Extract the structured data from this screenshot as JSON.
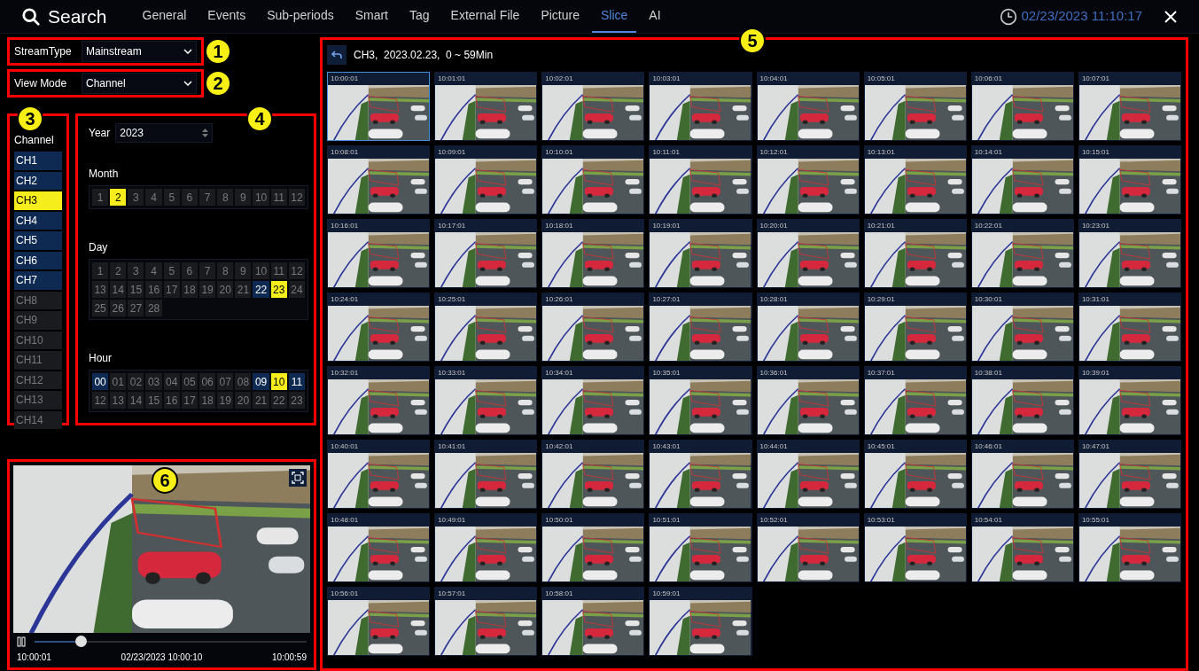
{
  "header": {
    "title": "Search",
    "datetime": "02/23/2023 11:10:17",
    "tabs": [
      {
        "label": "General",
        "selected": false
      },
      {
        "label": "Events",
        "selected": false
      },
      {
        "label": "Sub-periods",
        "selected": false
      },
      {
        "label": "Smart",
        "selected": false
      },
      {
        "label": "Tag",
        "selected": false
      },
      {
        "label": "External File",
        "selected": false
      },
      {
        "label": "Picture",
        "selected": false
      },
      {
        "label": "Slice",
        "selected": true
      },
      {
        "label": "AI",
        "selected": false
      }
    ]
  },
  "filters": [
    {
      "label": "StreamType",
      "value": "Mainstream",
      "callout": "1"
    },
    {
      "label": "View Mode",
      "value": "Channel",
      "callout": "2"
    }
  ],
  "channels": {
    "callout": "3",
    "title": "Channel",
    "items": [
      {
        "label": "CH1",
        "selected": false,
        "recorded": true
      },
      {
        "label": "CH2",
        "selected": false,
        "recorded": true
      },
      {
        "label": "CH3",
        "selected": true,
        "recorded": true
      },
      {
        "label": "CH4",
        "selected": false,
        "recorded": true
      },
      {
        "label": "CH5",
        "selected": false,
        "recorded": true
      },
      {
        "label": "CH6",
        "selected": false,
        "recorded": true
      },
      {
        "label": "CH7",
        "selected": false,
        "recorded": true
      },
      {
        "label": "CH8",
        "selected": false,
        "recorded": false
      },
      {
        "label": "CH9",
        "selected": false,
        "recorded": false
      },
      {
        "label": "CH10",
        "selected": false,
        "recorded": false
      },
      {
        "label": "CH11",
        "selected": false,
        "recorded": false
      },
      {
        "label": "CH12",
        "selected": false,
        "recorded": false
      },
      {
        "label": "CH13",
        "selected": false,
        "recorded": false
      },
      {
        "label": "CH14",
        "selected": false,
        "recorded": false
      }
    ]
  },
  "calendar": {
    "callout": "4",
    "year_label": "Year",
    "year": "2023",
    "sections": [
      {
        "title": "Month",
        "cells": [
          {
            "label": "1",
            "selected": false,
            "recorded": false
          },
          {
            "label": "2",
            "selected": true,
            "recorded": true
          },
          {
            "label": "3",
            "selected": false,
            "recorded": false
          },
          {
            "label": "4",
            "selected": false,
            "recorded": false
          },
          {
            "label": "5",
            "selected": false,
            "recorded": false
          },
          {
            "label": "6",
            "selected": false,
            "recorded": false
          },
          {
            "label": "7",
            "selected": false,
            "recorded": false
          },
          {
            "label": "8",
            "selected": false,
            "recorded": false
          },
          {
            "label": "9",
            "selected": false,
            "recorded": false
          },
          {
            "label": "10",
            "selected": false,
            "recorded": false
          },
          {
            "label": "11",
            "selected": false,
            "recorded": false
          },
          {
            "label": "12",
            "selected": false,
            "recorded": false
          }
        ]
      },
      {
        "title": "Day",
        "cells": [
          {
            "label": "1",
            "selected": false,
            "recorded": false
          },
          {
            "label": "2",
            "selected": false,
            "recorded": false
          },
          {
            "label": "3",
            "selected": false,
            "recorded": false
          },
          {
            "label": "4",
            "selected": false,
            "recorded": false
          },
          {
            "label": "5",
            "selected": false,
            "recorded": false
          },
          {
            "label": "6",
            "selected": false,
            "recorded": false
          },
          {
            "label": "7",
            "selected": false,
            "recorded": false
          },
          {
            "label": "8",
            "selected": false,
            "recorded": false
          },
          {
            "label": "9",
            "selected": false,
            "recorded": false
          },
          {
            "label": "10",
            "selected": false,
            "recorded": false
          },
          {
            "label": "11",
            "selected": false,
            "recorded": false
          },
          {
            "label": "12",
            "selected": false,
            "recorded": false
          },
          {
            "label": "13",
            "selected": false,
            "recorded": false
          },
          {
            "label": "14",
            "selected": false,
            "recorded": false
          },
          {
            "label": "15",
            "selected": false,
            "recorded": false
          },
          {
            "label": "16",
            "selected": false,
            "recorded": false
          },
          {
            "label": "17",
            "selected": false,
            "recorded": false
          },
          {
            "label": "18",
            "selected": false,
            "recorded": false
          },
          {
            "label": "19",
            "selected": false,
            "recorded": false
          },
          {
            "label": "20",
            "selected": false,
            "recorded": false
          },
          {
            "label": "21",
            "selected": false,
            "recorded": false
          },
          {
            "label": "22",
            "selected": false,
            "recorded": true
          },
          {
            "label": "23",
            "selected": true,
            "recorded": true
          },
          {
            "label": "24",
            "selected": false,
            "recorded": false
          },
          {
            "label": "25",
            "selected": false,
            "recorded": false
          },
          {
            "label": "26",
            "selected": false,
            "recorded": false
          },
          {
            "label": "27",
            "selected": false,
            "recorded": false
          },
          {
            "label": "28",
            "selected": false,
            "recorded": false
          }
        ]
      },
      {
        "title": "Hour",
        "cells": [
          {
            "label": "00",
            "selected": false,
            "recorded": true
          },
          {
            "label": "01",
            "selected": false,
            "recorded": false
          },
          {
            "label": "02",
            "selected": false,
            "recorded": false
          },
          {
            "label": "03",
            "selected": false,
            "recorded": false
          },
          {
            "label": "04",
            "selected": false,
            "recorded": false
          },
          {
            "label": "05",
            "selected": false,
            "recorded": false
          },
          {
            "label": "06",
            "selected": false,
            "recorded": false
          },
          {
            "label": "07",
            "selected": false,
            "recorded": false
          },
          {
            "label": "08",
            "selected": false,
            "recorded": false
          },
          {
            "label": "09",
            "selected": false,
            "recorded": true
          },
          {
            "label": "10",
            "selected": true,
            "recorded": true
          },
          {
            "label": "11",
            "selected": false,
            "recorded": true
          },
          {
            "label": "12",
            "selected": false,
            "recorded": false
          },
          {
            "label": "13",
            "selected": false,
            "recorded": false
          },
          {
            "label": "14",
            "selected": false,
            "recorded": false
          },
          {
            "label": "15",
            "selected": false,
            "recorded": false
          },
          {
            "label": "16",
            "selected": false,
            "recorded": false
          },
          {
            "label": "17",
            "selected": false,
            "recorded": false
          },
          {
            "label": "18",
            "selected": false,
            "recorded": false
          },
          {
            "label": "19",
            "selected": false,
            "recorded": false
          },
          {
            "label": "20",
            "selected": false,
            "recorded": false
          },
          {
            "label": "21",
            "selected": false,
            "recorded": false
          },
          {
            "label": "22",
            "selected": false,
            "recorded": false
          },
          {
            "label": "23",
            "selected": false,
            "recorded": false
          }
        ]
      }
    ]
  },
  "slices": {
    "callout": "5",
    "caption": "CH3,  2023.02.23,  0 ~ 59Min",
    "thumbnails": [
      {
        "time": "10:00:01",
        "selected": true
      },
      {
        "time": "10:01:01",
        "selected": false
      },
      {
        "time": "10:02:01",
        "selected": false
      },
      {
        "time": "10:03:01",
        "selected": false
      },
      {
        "time": "10:04:01",
        "selected": false
      },
      {
        "time": "10:05:01",
        "selected": false
      },
      {
        "time": "10:06:01",
        "selected": false
      },
      {
        "time": "10:07:01",
        "selected": false
      },
      {
        "time": "10:08:01",
        "selected": false
      },
      {
        "time": "10:09:01",
        "selected": false
      },
      {
        "time": "10:10:01",
        "selected": false
      },
      {
        "time": "10:11:01",
        "selected": false
      },
      {
        "time": "10:12:01",
        "selected": false
      },
      {
        "time": "10:13:01",
        "selected": false
      },
      {
        "time": "10:14:01",
        "selected": false
      },
      {
        "time": "10:15:01",
        "selected": false
      },
      {
        "time": "10:16:01",
        "selected": false
      },
      {
        "time": "10:17:01",
        "selected": false
      },
      {
        "time": "10:18:01",
        "selected": false
      },
      {
        "time": "10:19:01",
        "selected": false
      },
      {
        "time": "10:20:01",
        "selected": false
      },
      {
        "time": "10:21:01",
        "selected": false
      },
      {
        "time": "10:22:01",
        "selected": false
      },
      {
        "time": "10:23:01",
        "selected": false
      },
      {
        "time": "10:24:01",
        "selected": false
      },
      {
        "time": "10:25:01",
        "selected": false
      },
      {
        "time": "10:26:01",
        "selected": false
      },
      {
        "time": "10:27:01",
        "selected": false
      },
      {
        "time": "10:28:01",
        "selected": false
      },
      {
        "time": "10:29:01",
        "selected": false
      },
      {
        "time": "10:30:01",
        "selected": false
      },
      {
        "time": "10:31:01",
        "selected": false
      },
      {
        "time": "10:32:01",
        "selected": false
      },
      {
        "time": "10:33:01",
        "selected": false
      },
      {
        "time": "10:34:01",
        "selected": false
      },
      {
        "time": "10:35:01",
        "selected": false
      },
      {
        "time": "10:36:01",
        "selected": false
      },
      {
        "time": "10:37:01",
        "selected": false
      },
      {
        "time": "10:38:01",
        "selected": false
      },
      {
        "time": "10:39:01",
        "selected": false
      },
      {
        "time": "10:40:01",
        "selected": false
      },
      {
        "time": "10:41:01",
        "selected": false
      },
      {
        "time": "10:42:01",
        "selected": false
      },
      {
        "time": "10:43:01",
        "selected": false
      },
      {
        "time": "10:44:01",
        "selected": false
      },
      {
        "time": "10:45:01",
        "selected": false
      },
      {
        "time": "10:46:01",
        "selected": false
      },
      {
        "time": "10:47:01",
        "selected": false
      },
      {
        "time": "10:48:01",
        "selected": false
      },
      {
        "time": "10:49:01",
        "selected": false
      },
      {
        "time": "10:50:01",
        "selected": false
      },
      {
        "time": "10:51:01",
        "selected": false
      },
      {
        "time": "10:52:01",
        "selected": false
      },
      {
        "time": "10:53:01",
        "selected": false
      },
      {
        "time": "10:54:01",
        "selected": false
      },
      {
        "time": "10:55:01",
        "selected": false
      },
      {
        "time": "10:56:01",
        "selected": false
      },
      {
        "time": "10:57:01",
        "selected": false
      },
      {
        "time": "10:58:01",
        "selected": false
      },
      {
        "time": "10:59:01",
        "selected": false
      }
    ]
  },
  "player": {
    "callout": "6",
    "level": 0.17,
    "start": "10:00:01",
    "current": "02/23/2023 10:00:10",
    "end": "10:00:59"
  }
}
